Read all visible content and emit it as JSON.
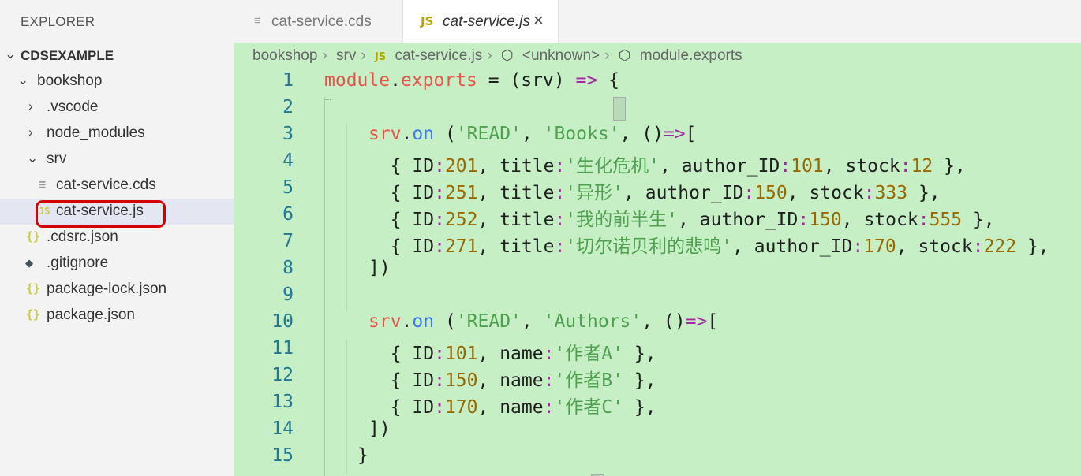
{
  "sidebar": {
    "title": "EXPLORER",
    "root": "CDSEXAMPLE",
    "items": [
      {
        "label": "bookshop"
      },
      {
        "label": ".vscode"
      },
      {
        "label": "node_modules"
      },
      {
        "label": "srv"
      },
      {
        "label": "cat-service.cds"
      },
      {
        "label": "cat-service.js"
      },
      {
        "label": ".cdsrc.json"
      },
      {
        "label": ".gitignore"
      },
      {
        "label": "package-lock.json"
      },
      {
        "label": "package.json"
      }
    ]
  },
  "tabs": [
    {
      "label": "cat-service.cds",
      "active": false
    },
    {
      "label": "cat-service.js",
      "active": true,
      "badge": "JS",
      "close": "×"
    }
  ],
  "breadcrumb": {
    "parts": [
      "bookshop",
      "srv",
      "cat-service.js",
      "<unknown>",
      "module.exports"
    ],
    "badge": "JS"
  },
  "editor": {
    "line_numbers": [
      "1",
      "2",
      "3",
      "4",
      "5",
      "6",
      "7",
      "8",
      "9",
      "10",
      "11",
      "12",
      "13",
      "14",
      "15"
    ],
    "code": {
      "l1_module": "module",
      "l1_dot": ".",
      "l1_exports": "exports",
      "l1_rest1": " = (srv) ",
      "l1_arrow": "=>",
      "l1_rest2": " ",
      "l1_brace": "{",
      "srv": "srv",
      "dot": ".",
      "on": "on",
      "l3_open": " (",
      "read": "'READ'",
      "comma": ", ",
      "books": "'Books'",
      "fn_open": ", ()",
      "arrow": "=>",
      "bracket_open": "[",
      "obj_open": "  { ",
      "id_key": "ID",
      "colon": ":",
      "title_key": "title",
      "author_key": "author_ID",
      "stock_key": "stock",
      "name_key": "name",
      "obj_close": " },",
      "sep": ", ",
      "books_rows": [
        {
          "id": "201",
          "title": "'生化危机'",
          "author": "101",
          "stock": "12"
        },
        {
          "id": "251",
          "title": "'异形'",
          "author": "150",
          "stock": "333"
        },
        {
          "id": "252",
          "title": "'我的前半生'",
          "author": "150",
          "stock": "555"
        },
        {
          "id": "271",
          "title": "'切尔诺贝利的悲鸣'",
          "author": "170",
          "stock": "222"
        }
      ],
      "close_bracket": "])",
      "authors": "'Authors'",
      "authors_rows": [
        {
          "id": "101",
          "name": "'作者A'"
        },
        {
          "id": "150",
          "name": "'作者B'"
        },
        {
          "id": "170",
          "name": "'作者C'"
        }
      ],
      "final_brace": "}",
      "dots": "..."
    }
  }
}
